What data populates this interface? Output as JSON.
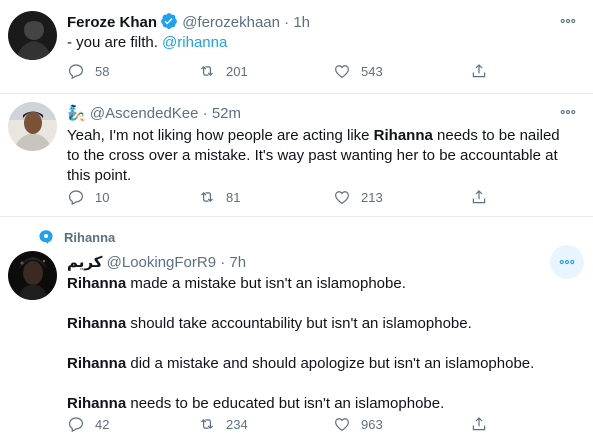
{
  "tweets": [
    {
      "name": "Feroze Khan",
      "handle": "@ferozekhaan",
      "sep": "·",
      "time": "1h",
      "text_prefix": "- you are filth. ",
      "mention": "@rihanna",
      "replies": "58",
      "retweets": "201",
      "likes": "543"
    },
    {
      "name_emoji": "🧞",
      "handle": "@AscendedKee",
      "sep": "·",
      "time": "52m",
      "t1": "Yeah, I'm not liking how people are acting like ",
      "b1": "Rihanna",
      "t2": " needs to be nailed",
      "line2": "to the cross over a mistake. It's way past wanting her to be accountable at",
      "line3": "this point.",
      "replies": "10",
      "retweets": "81",
      "likes": "213"
    },
    {
      "context": "Rihanna",
      "name": "كريم",
      "handle": "@LookingForR9",
      "sep": "·",
      "time": "7h",
      "lines": [
        {
          "bold": "Rihanna",
          "rest": " made a mistake but isn't an islamophobe."
        },
        {
          "bold": "Rihanna",
          "rest": " should take accountability but isn't an islamophobe."
        },
        {
          "bold": "Rihanna",
          "rest": " did a mistake and should apologize but isn't an islamophobe."
        },
        {
          "bold": "Rihanna",
          "rest": " needs to be educated but isn't an islamophobe."
        }
      ],
      "replies": "42",
      "retweets": "234",
      "likes": "963"
    }
  ],
  "colors": {
    "accent": "#1da1f2",
    "muted": "#5b7083",
    "text": "#0f1419",
    "divider": "#ebeef0"
  },
  "icons": [
    "verified-badge-icon",
    "more-icon",
    "reply-icon",
    "retweet-icon",
    "like-icon",
    "share-icon",
    "topic-icon"
  ]
}
